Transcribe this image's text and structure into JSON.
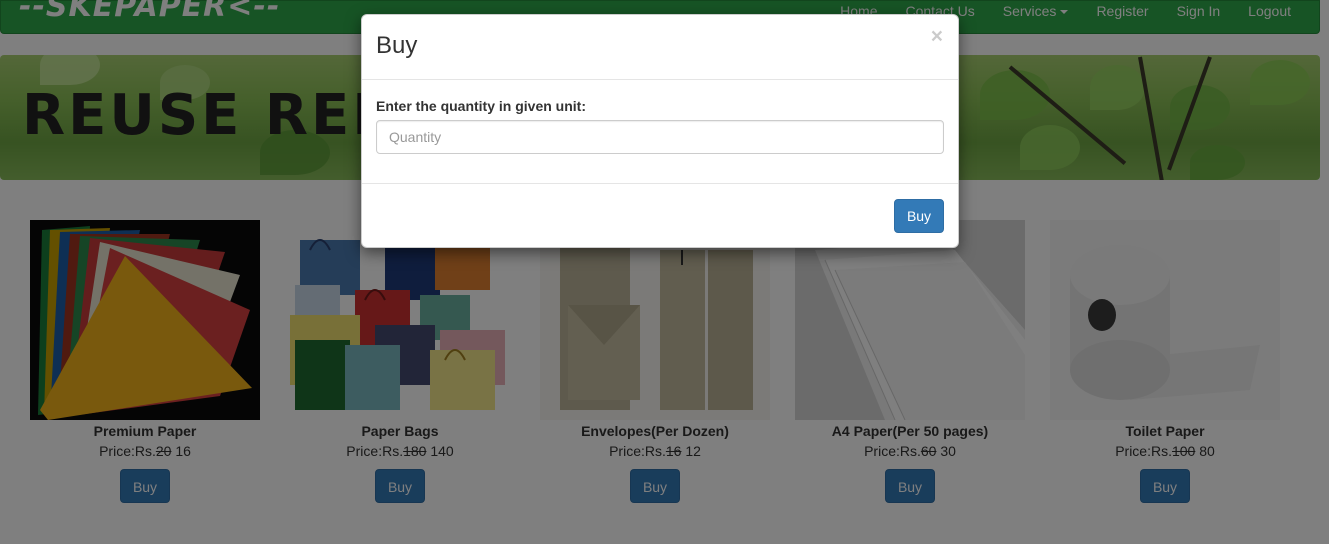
{
  "navbar": {
    "logo": "--SKEPAPER<--",
    "items": [
      {
        "label": "Home"
      },
      {
        "label": "Contact Us"
      },
      {
        "label": "Services",
        "has_caret": true
      },
      {
        "label": "Register"
      },
      {
        "label": "Sign In"
      },
      {
        "label": "Logout"
      }
    ]
  },
  "banner": {
    "text": "REUSE REDUCE"
  },
  "products": [
    {
      "name": "Premium Paper",
      "price_prefix": "Price:Rs.",
      "old_price": "20",
      "new_price": "16",
      "buy_label": "Buy"
    },
    {
      "name": "Paper Bags",
      "price_prefix": "Price:Rs.",
      "old_price": "180",
      "new_price": "140",
      "buy_label": "Buy"
    },
    {
      "name": "Envelopes(Per Dozen)",
      "price_prefix": "Price:Rs.",
      "old_price": "16",
      "new_price": "12",
      "buy_label": "Buy"
    },
    {
      "name": "A4 Paper(Per 50 pages)",
      "price_prefix": "Price:Rs.",
      "old_price": "60",
      "new_price": "30",
      "buy_label": "Buy"
    },
    {
      "name": "Toilet Paper",
      "price_prefix": "Price:Rs.",
      "old_price": "100",
      "new_price": "80",
      "buy_label": "Buy"
    }
  ],
  "modal": {
    "title": "Buy",
    "close_symbol": "×",
    "label": "Enter the quantity in given unit:",
    "input_placeholder": "Quantity",
    "input_value": "",
    "submit_label": "Buy"
  },
  "colors": {
    "navbar": "#2fa84a",
    "primary_button": "#337ab7",
    "overlay": "rgba(0,0,0,0.5)"
  }
}
